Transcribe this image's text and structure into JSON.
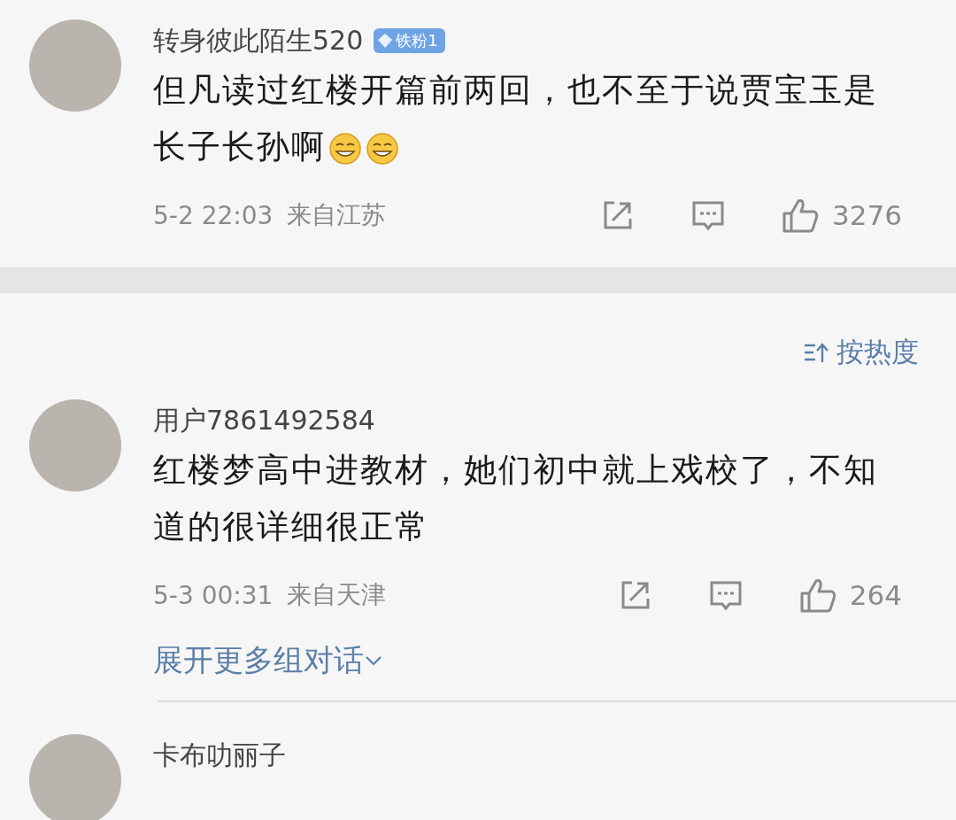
{
  "comments": [
    {
      "username": "转身彼此陌生520",
      "badge": {
        "label": "铁粉1"
      },
      "text_lines": [
        "但凡读过红楼开篇前两回，也不至于说贾宝玉是",
        "长子长孙啊"
      ],
      "emojis": [
        {
          "kind": "grin"
        },
        {
          "kind": "grin"
        }
      ],
      "time": "5-2 22:03",
      "location": "来自江苏",
      "likes": "3276"
    }
  ],
  "sort": {
    "label": "按热度"
  },
  "replies": [
    {
      "username": "用户7861492584",
      "text_lines": [
        "红楼梦高中进教材，她们初中就上戏校了，不知",
        "道的很详细很正常"
      ],
      "time": "5-3 00:31",
      "location": "来自天津",
      "likes": "264",
      "expand": "展开更多组对话"
    },
    {
      "username": "卡布叻丽子"
    }
  ]
}
